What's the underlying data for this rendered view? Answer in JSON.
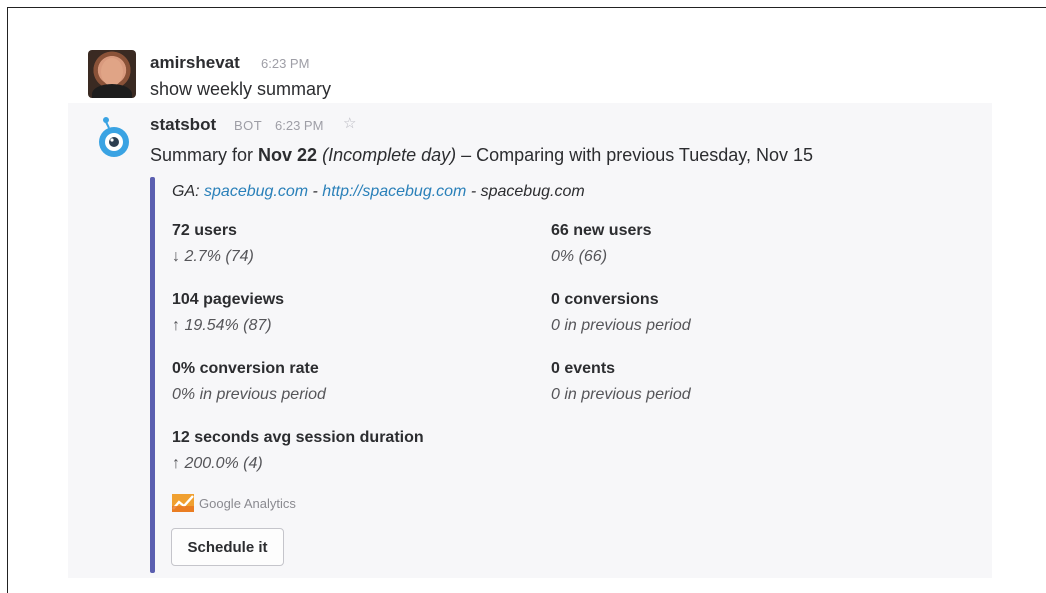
{
  "user_message": {
    "name": "amirshevat",
    "time": "6:23 PM",
    "text": "show weekly summary"
  },
  "bot_message": {
    "name": "statsbot",
    "tag": "BOT",
    "time": "6:23 PM",
    "star_icon": "☆",
    "summary": {
      "prefix": "Summary for ",
      "date": "Nov 22",
      "note": "(Incomplete day)",
      "suffix": " – Comparing with previous Tuesday, Nov 15"
    },
    "attachment": {
      "accent": "#5b5fb0",
      "ga_prefix": "GA: ",
      "link1": "spacebug.com",
      "sep1": " - ",
      "link2": "http://spacebug.com",
      "sep2": " - ",
      "plain": "spacebug.com",
      "fields": [
        {
          "title": "72 users",
          "value": "↓ 2.7% (74)"
        },
        {
          "title": "66 new users",
          "value": "0% (66)"
        },
        {
          "title": "104 pageviews",
          "value": "↑ 19.54% (87)"
        },
        {
          "title": "0 conversions",
          "value": "0 in previous period"
        },
        {
          "title": "0% conversion rate",
          "value": "0% in previous period"
        },
        {
          "title": "0 events",
          "value": "0 in previous period"
        },
        {
          "title": "12 seconds avg session duration",
          "value": "↑ 200.0% (4)"
        }
      ],
      "footer": "Google Analytics",
      "button_label": "Schedule it"
    }
  }
}
